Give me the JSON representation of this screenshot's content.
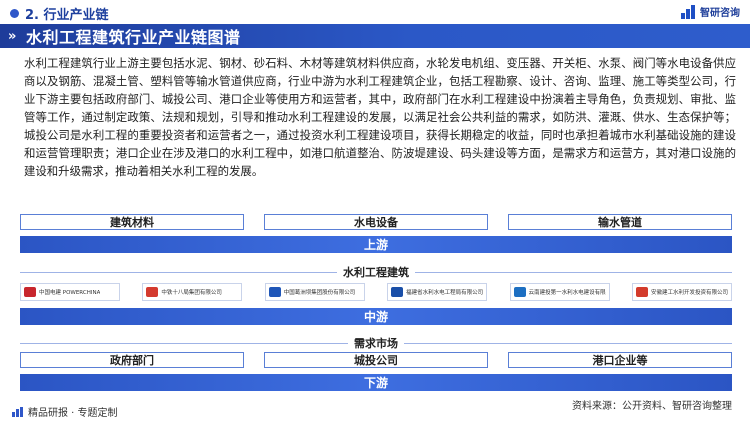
{
  "header": {
    "section_title": "2. 行业产业链",
    "logo_text": "智研咨询"
  },
  "title_bar": {
    "title": "水利工程建筑行业产业链图谱"
  },
  "description": "水利工程建筑行业上游主要包括水泥、钢材、砂石料、木材等建筑材料供应商，水轮发电机组、变压器、开关柜、水泵、阀门等水电设备供应商以及钢筋、混凝土管、塑料管等输水管道供应商，行业中游为水利工程建筑企业，包括工程勘察、设计、咨询、监理、施工等类型公司，行业下游主要包括政府部门、城投公司、港口企业等使用方和运营者，其中，政府部门在水利工程建设中扮演着主导角色，负责规划、审批、监管等工作，通过制定政策、法规和规划，引导和推动水利工程建设的发展，以满足社会公共利益的需求，如防洪、灌溉、供水、生态保护等；城投公司是水利工程的重要投资者和运营者之一，通过投资水利工程建设项目，获得长期稳定的收益，同时也承担着城市水利基础设施的建设和运营管理职责；港口企业在涉及港口的水利工程中，如港口航道整治、防波堤建设、码头建设等方面，是需求方和运营方，其对港口设施的建设和升级需求，推动着相关水利工程的发展。",
  "upstream": {
    "items": [
      "建筑材料",
      "水电设备",
      "输水管道"
    ],
    "tier_label": "上游"
  },
  "midstream": {
    "caption": "水利工程建筑",
    "companies": [
      {
        "name": "中国电建 POWERCHINA",
        "color": "#c8262d"
      },
      {
        "name": "中铁十八局集团有限公司",
        "color": "#d43a2f"
      },
      {
        "name": "中国葛洲坝集团股份有限公司",
        "color": "#1f56b8"
      },
      {
        "name": "福建省水利水电工程局有限公司",
        "color": "#1a4fa8"
      },
      {
        "name": "云南建投第一水利水电建设有限公司",
        "color": "#1d6fc2"
      },
      {
        "name": "安徽建工水利开发投资有限公司",
        "color": "#d33b2c"
      }
    ],
    "tier_label": "中游"
  },
  "downstream": {
    "caption": "需求市场",
    "items": [
      "政府部门",
      "城投公司",
      "港口企业等"
    ],
    "tier_label": "下游"
  },
  "footer": {
    "left_text": "精品研报 · 专题定制",
    "source": "资料来源：公开资料、智研咨询整理"
  }
}
